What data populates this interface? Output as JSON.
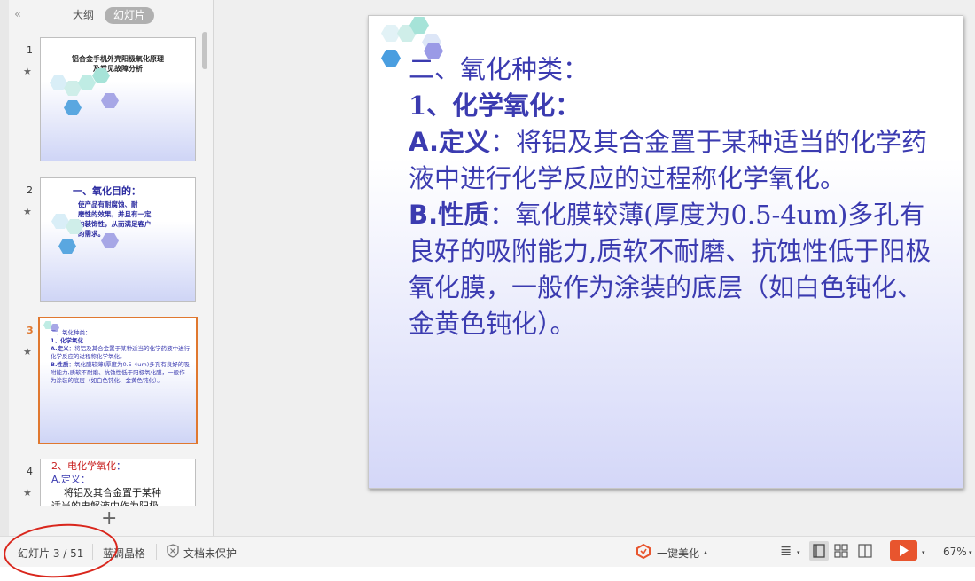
{
  "panel": {
    "collapse_glyph": "«",
    "tabs": [
      {
        "label": "大纲"
      },
      {
        "label": "幻灯片"
      }
    ],
    "add_glyph": "+",
    "thumbnails": [
      {
        "number": "1",
        "star": "★",
        "title": "铝合金手机外壳阳极氧化原理\n及常见故障分析"
      },
      {
        "number": "2",
        "star": "★",
        "title": "一、氧化目的：",
        "body": "使产品有耐腐蚀、耐\n磨性的效果，并且有一定\n的装饰性，从而满足客户\n的需求。"
      },
      {
        "number": "3",
        "star": "★",
        "heading": "二、氧化种类：",
        "sub": "1、化学氧化",
        "a_label": "A.定义",
        "a_text": "：将铝及其合金置于某种适当的化学药液中进行化学反应的过程称化学氧化。",
        "b_label": "B.性质",
        "b_text": "：氧化膜较薄(厚度为0.5-4um)多孔有良好的吸附能力,质软不耐磨、抗蚀性低于阳极氧化膜，一般作为涂装的底层（如白色钝化、金黄色钝化）。"
      },
      {
        "number": "4",
        "star": "★",
        "title_red": "2、电化学氧化",
        "colon": "：",
        "line2": "A.定义：",
        "line3": "将铝及其合金置于某种",
        "line4": "适当的电解液中作为阳极"
      }
    ]
  },
  "slide": {
    "line1": "二、氧化种类：",
    "line2": "1、化学氧化：",
    "a_label": "A.定义",
    "a_text": "：将铝及其合金置于某种适当的化学药液中进行化学反应的过程称化学氧化。",
    "b_label": "B.性质",
    "b_text": "：氧化膜较薄(厚度为0.5-4um)多孔有良好的吸附能力,质软不耐磨、抗蚀性低于阳极氧化膜，一般作为涂装的底层（如白色钝化、金黄色钝化）。"
  },
  "status": {
    "slide_counter": "幻灯片 3 / 51",
    "theme": "蓝调晶格",
    "protection": "文档未保护",
    "beautify": "一键美化",
    "beautify_arrow": "▴",
    "zoom": "67%",
    "zoom_arrow": "▾",
    "notes_glyph": "≣",
    "dropdown_glyph": "▾"
  },
  "colors": {
    "accent": "#e0782f",
    "slide_text": "#3b3bb0",
    "red_annotation": "#d9261c",
    "play_button": "#e8552e"
  },
  "icons": [
    "collapse-icon",
    "star-icon",
    "add-slide-icon",
    "shield-icon",
    "beautify-icon",
    "notes-icon",
    "normal-view-icon",
    "grid-view-icon",
    "reading-view-icon",
    "play-icon",
    "dropdown-icon"
  ]
}
